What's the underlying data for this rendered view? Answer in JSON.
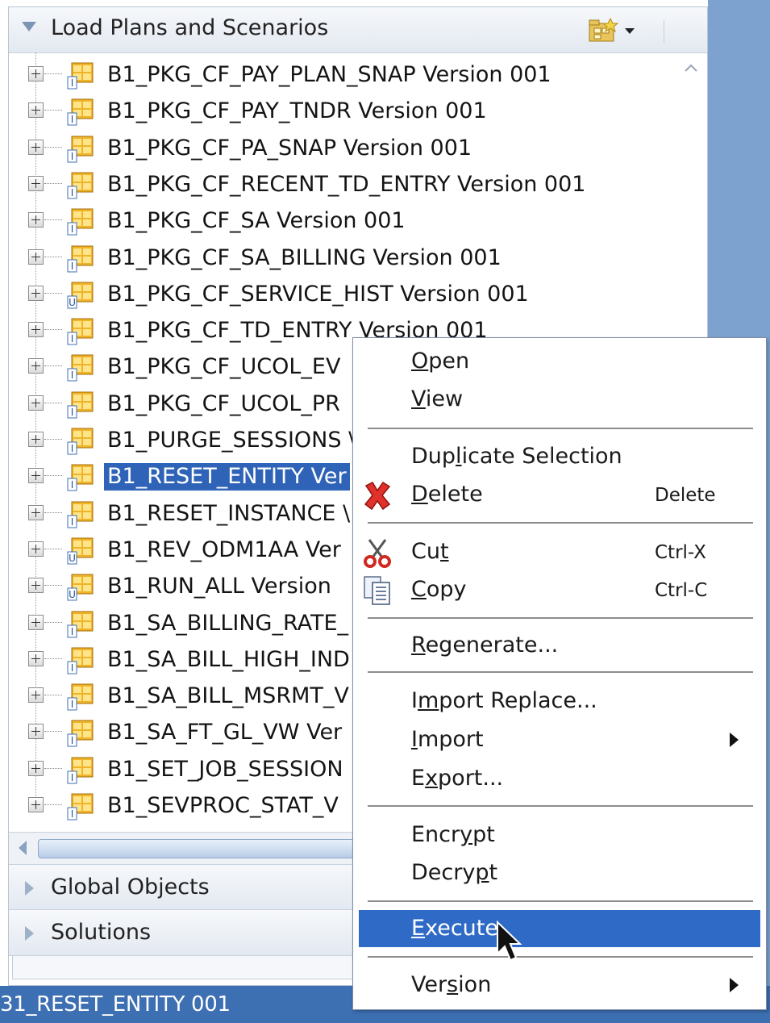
{
  "panel": {
    "title": "Load Plans and Scenarios",
    "icons": [
      "collapse-triangle-icon",
      "scenario-folder-add-icon",
      "dropdown-arrow-icon"
    ]
  },
  "tree": {
    "items": [
      {
        "label": "B1_PKG_CF_PAY_PLAN_SNAP Version 001",
        "badge": "I"
      },
      {
        "label": "B1_PKG_CF_PAY_TNDR Version 001",
        "badge": "I"
      },
      {
        "label": "B1_PKG_CF_PA_SNAP Version 001",
        "badge": "I"
      },
      {
        "label": "B1_PKG_CF_RECENT_TD_ENTRY Version 001",
        "badge": "I"
      },
      {
        "label": "B1_PKG_CF_SA Version 001",
        "badge": "I"
      },
      {
        "label": "B1_PKG_CF_SA_BILLING Version 001",
        "badge": "I"
      },
      {
        "label": "B1_PKG_CF_SERVICE_HIST Version 001",
        "badge": "U"
      },
      {
        "label": "B1_PKG_CF_TD_ENTRY Version 001",
        "badge": "I"
      },
      {
        "label": "B1_PKG_CF_UCOL_EV",
        "badge": "I"
      },
      {
        "label": "B1_PKG_CF_UCOL_PR",
        "badge": "I"
      },
      {
        "label": "B1_PURGE_SESSIONS \\",
        "badge": "I"
      },
      {
        "label": "B1_RESET_ENTITY Ver",
        "badge": "I",
        "selected": true
      },
      {
        "label": "B1_RESET_INSTANCE \\",
        "badge": "I"
      },
      {
        "label": "B1_REV_ODM1AA Ver",
        "badge": "U"
      },
      {
        "label": "B1_RUN_ALL Version",
        "badge": "U"
      },
      {
        "label": "B1_SA_BILLING_RATE_",
        "badge": "I"
      },
      {
        "label": "B1_SA_BILL_HIGH_IND",
        "badge": "I"
      },
      {
        "label": "B1_SA_BILL_MSRMT_V",
        "badge": "I"
      },
      {
        "label": "B1_SA_FT_GL_VW Ver",
        "badge": "I"
      },
      {
        "label": "B1_SET_JOB_SESSION",
        "badge": "I"
      },
      {
        "label": "B1_SEVPROC_STAT_V",
        "badge": "I"
      }
    ]
  },
  "accordion": {
    "global_objects": "Global Objects",
    "solutions": "Solutions"
  },
  "status_bar": {
    "text": "31_RESET_ENTITY 001"
  },
  "context_menu": {
    "open": {
      "pre": "",
      "u": "O",
      "post": "pen"
    },
    "view": {
      "pre": "",
      "u": "V",
      "post": "iew"
    },
    "duplicate": {
      "pre": "Dup",
      "u": "l",
      "post": "icate Selection"
    },
    "delete": {
      "pre": "",
      "u": "D",
      "post": "elete",
      "accel": "Delete"
    },
    "cut": {
      "pre": "Cu",
      "u": "t",
      "post": "",
      "accel": "Ctrl-X"
    },
    "copy": {
      "pre": "",
      "u": "C",
      "post": "opy",
      "accel": "Ctrl-C"
    },
    "regenerate": {
      "pre": "",
      "u": "R",
      "post": "egenerate..."
    },
    "import_replace": {
      "pre": "I",
      "u": "m",
      "post": "port Replace..."
    },
    "import": {
      "pre": "",
      "u": "I",
      "post": "mport"
    },
    "export": {
      "pre": "E",
      "u": "x",
      "post": "port..."
    },
    "encrypt": {
      "pre": "Encr",
      "u": "y",
      "post": "pt"
    },
    "decrypt": {
      "pre": "Decry",
      "u": "p",
      "post": "t"
    },
    "execute": {
      "pre": "",
      "u": "E",
      "post": "xecute"
    },
    "version": {
      "pre": "Ver",
      "u": "s",
      "post": "ion"
    }
  },
  "colors": {
    "selection": "#2e63b7",
    "menu_highlight": "#2f6bc6",
    "status_bar": "#3d6fb3",
    "desktop": "#7ea2cf"
  }
}
